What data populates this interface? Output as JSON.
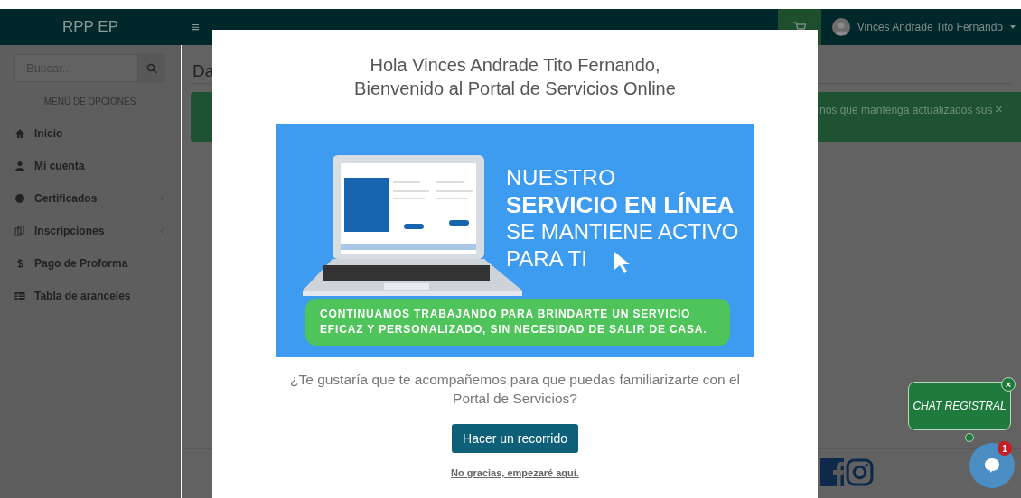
{
  "header": {
    "brand": "RPP EP",
    "menu_toggle": "≡",
    "user_name": "Vinces Andrade Tito Fernando"
  },
  "sidebar": {
    "search": {
      "placeholder": "Buscar..."
    },
    "heading": "MENÚ DE OPCIONES",
    "items": [
      {
        "label": "Inicio",
        "has_submenu": false
      },
      {
        "label": "Mi cuenta",
        "has_submenu": false
      },
      {
        "label": "Certificados",
        "has_submenu": true
      },
      {
        "label": "Inscripciones",
        "has_submenu": true
      },
      {
        "label": "Pago de Proforma",
        "has_submenu": false
      },
      {
        "label": "Tabla de aranceles",
        "has_submenu": false
      }
    ]
  },
  "content": {
    "title": "Da",
    "alert": {
      "text": "nos que mantenga actualizados sus",
      "close": "×"
    }
  },
  "modal": {
    "title_lines": [
      "Hola Vinces Andrade Tito Fernando,",
      "Bienvenido al Portal de Servicios Online"
    ],
    "banner": {
      "line_1": "NUESTRO",
      "line_2": "SERVICIO EN LÍNEA",
      "line_3": "SE MANTIENE ACTIVO",
      "line_4": "PARA TI",
      "footer": "CONTINUAMOS TRABAJANDO PARA BRINDARTE UN SERVICIO EFICAZ Y PERSONALIZADO, SIN NECESIDAD DE SALIR DE CASA."
    },
    "question": "¿Te gustaría que te acompañemos para que puedas familiarizarte con el Portal de Servicios?",
    "primary_button": "Hacer un recorrido",
    "skip_link": "No gracias, empezaré aquí."
  },
  "chat": {
    "label": "CHAT REGISTRAL",
    "close": "×",
    "badge": "1"
  }
}
